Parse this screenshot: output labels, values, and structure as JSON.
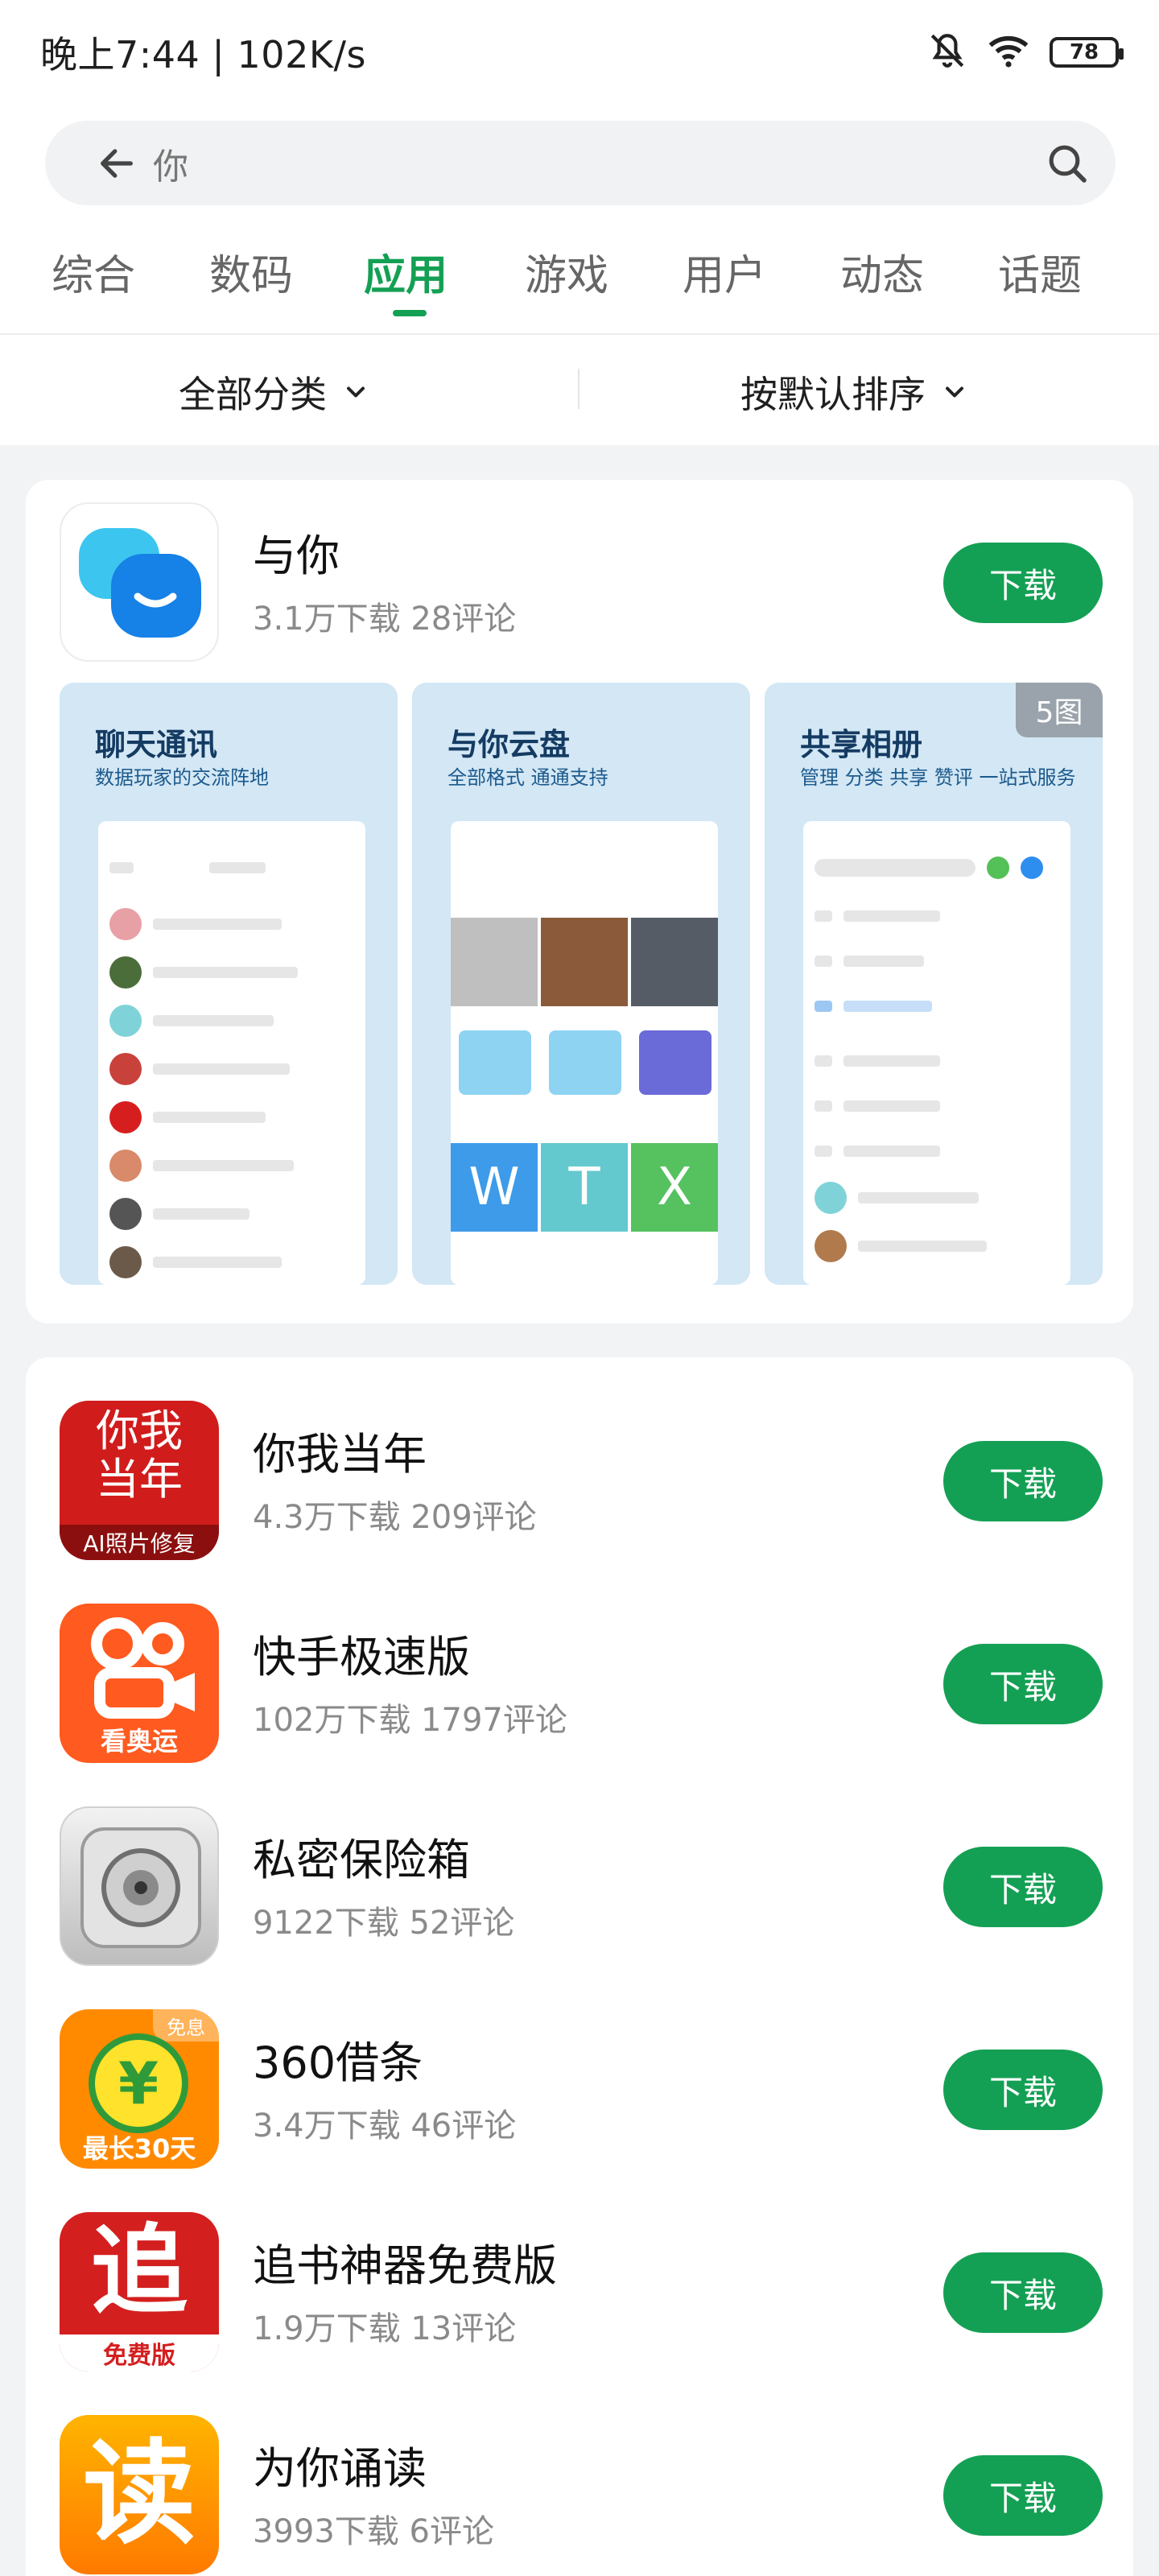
{
  "status_bar": {
    "time": "晚上7:44 | 102K/s",
    "battery": "78"
  },
  "search": {
    "query": "你"
  },
  "tabs": [
    "综合",
    "数码",
    "应用",
    "游戏",
    "用户",
    "动态",
    "话题"
  ],
  "active_tab": "应用",
  "filters": {
    "category": "全部分类",
    "sort": "按默认排序"
  },
  "featured": {
    "name": "与你",
    "meta": "3.1万下载  28评论",
    "download_label": "下载",
    "more_badge": "5图",
    "screens": [
      {
        "title": "聊天通讯",
        "subtitle": "数据玩家的交流阵地"
      },
      {
        "title": "与你云盘",
        "subtitle": "全部格式 通通支持"
      },
      {
        "title": "共享相册",
        "subtitle": "管理 分类 共享 赞评 一站式服务"
      }
    ]
  },
  "apps": [
    {
      "name": "你我当年",
      "meta": "4.3万下载  209评论",
      "download_label": "下载",
      "icon": "nwdn-icon"
    },
    {
      "name": "快手极速版",
      "meta": "102万下载  1797评论",
      "download_label": "下载",
      "icon": "kuaishou-icon"
    },
    {
      "name": "私密保险箱",
      "meta": "9122下载  52评论",
      "download_label": "下载",
      "icon": "safe-icon"
    },
    {
      "name": "360借条",
      "meta": "3.4万下载  46评论",
      "download_label": "下载",
      "icon": "jietiao-icon"
    },
    {
      "name": "追书神器免费版",
      "meta": "1.9万下载  13评论",
      "download_label": "下载",
      "icon": "zhuishu-icon"
    },
    {
      "name": "为你诵读",
      "meta": "3993下载  6评论",
      "download_label": "下载",
      "icon": "songdu-icon"
    }
  ],
  "icon_text": {
    "nwdn_top": "你我",
    "nwdn_mid": "当年",
    "nwdn_bottom": "AI照片修复",
    "kuaishou_bottom": "看奥运",
    "jietiao_corner": "免息",
    "jietiao_symbol": "¥",
    "jietiao_bottom": "最长30天",
    "zhuishu_char": "追",
    "zhuishu_bottom": "免费版",
    "songdu_char": "读"
  },
  "colors": {
    "accent": "#14a054"
  }
}
